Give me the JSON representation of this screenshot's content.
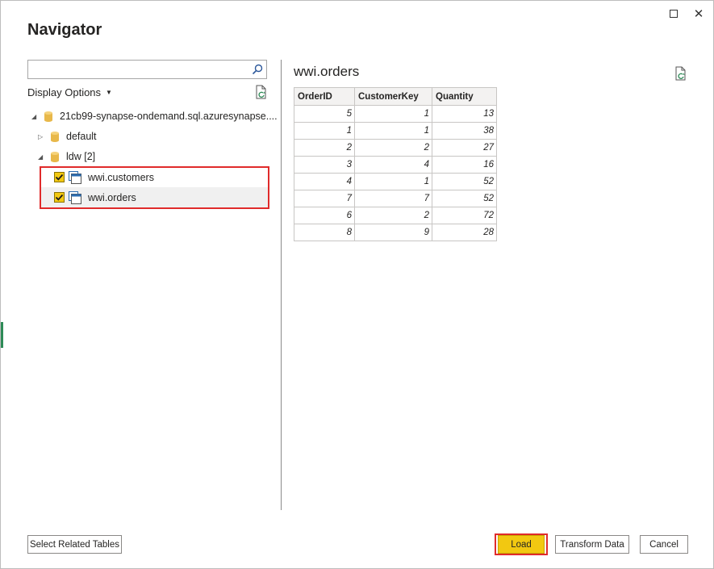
{
  "window": {
    "title": "Navigator",
    "maximize_icon": "maximize-icon",
    "close_icon": "close-icon"
  },
  "left_pane": {
    "search": {
      "value": "",
      "placeholder": ""
    },
    "display_options_label": "Display Options",
    "tree": {
      "server": {
        "label": "21cb99-synapse-ondemand.sql.azuresynapse....",
        "expanded": true
      },
      "databases": [
        {
          "label": "default",
          "expanded": false
        },
        {
          "label": "ldw [2]",
          "expanded": true
        }
      ],
      "tables": [
        {
          "label": "wwi.customers",
          "checked": true,
          "selected": false
        },
        {
          "label": "wwi.orders",
          "checked": true,
          "selected": true
        }
      ]
    }
  },
  "preview": {
    "title": "wwi.orders",
    "columns": [
      "OrderID",
      "CustomerKey",
      "Quantity"
    ],
    "rows": [
      [
        "5",
        "1",
        "13"
      ],
      [
        "1",
        "1",
        "38"
      ],
      [
        "2",
        "2",
        "27"
      ],
      [
        "3",
        "4",
        "16"
      ],
      [
        "4",
        "1",
        "52"
      ],
      [
        "7",
        "7",
        "52"
      ],
      [
        "6",
        "2",
        "72"
      ],
      [
        "8",
        "9",
        "28"
      ]
    ]
  },
  "buttons": {
    "select_related": "Select Related Tables",
    "load": "Load",
    "transform": "Transform Data",
    "cancel": "Cancel"
  },
  "colors": {
    "accent_yellow": "#f2c811",
    "highlight_red": "#e02b2b",
    "database_icon": "#e8b84a",
    "table_icon_blue": "#2b6cb0"
  }
}
